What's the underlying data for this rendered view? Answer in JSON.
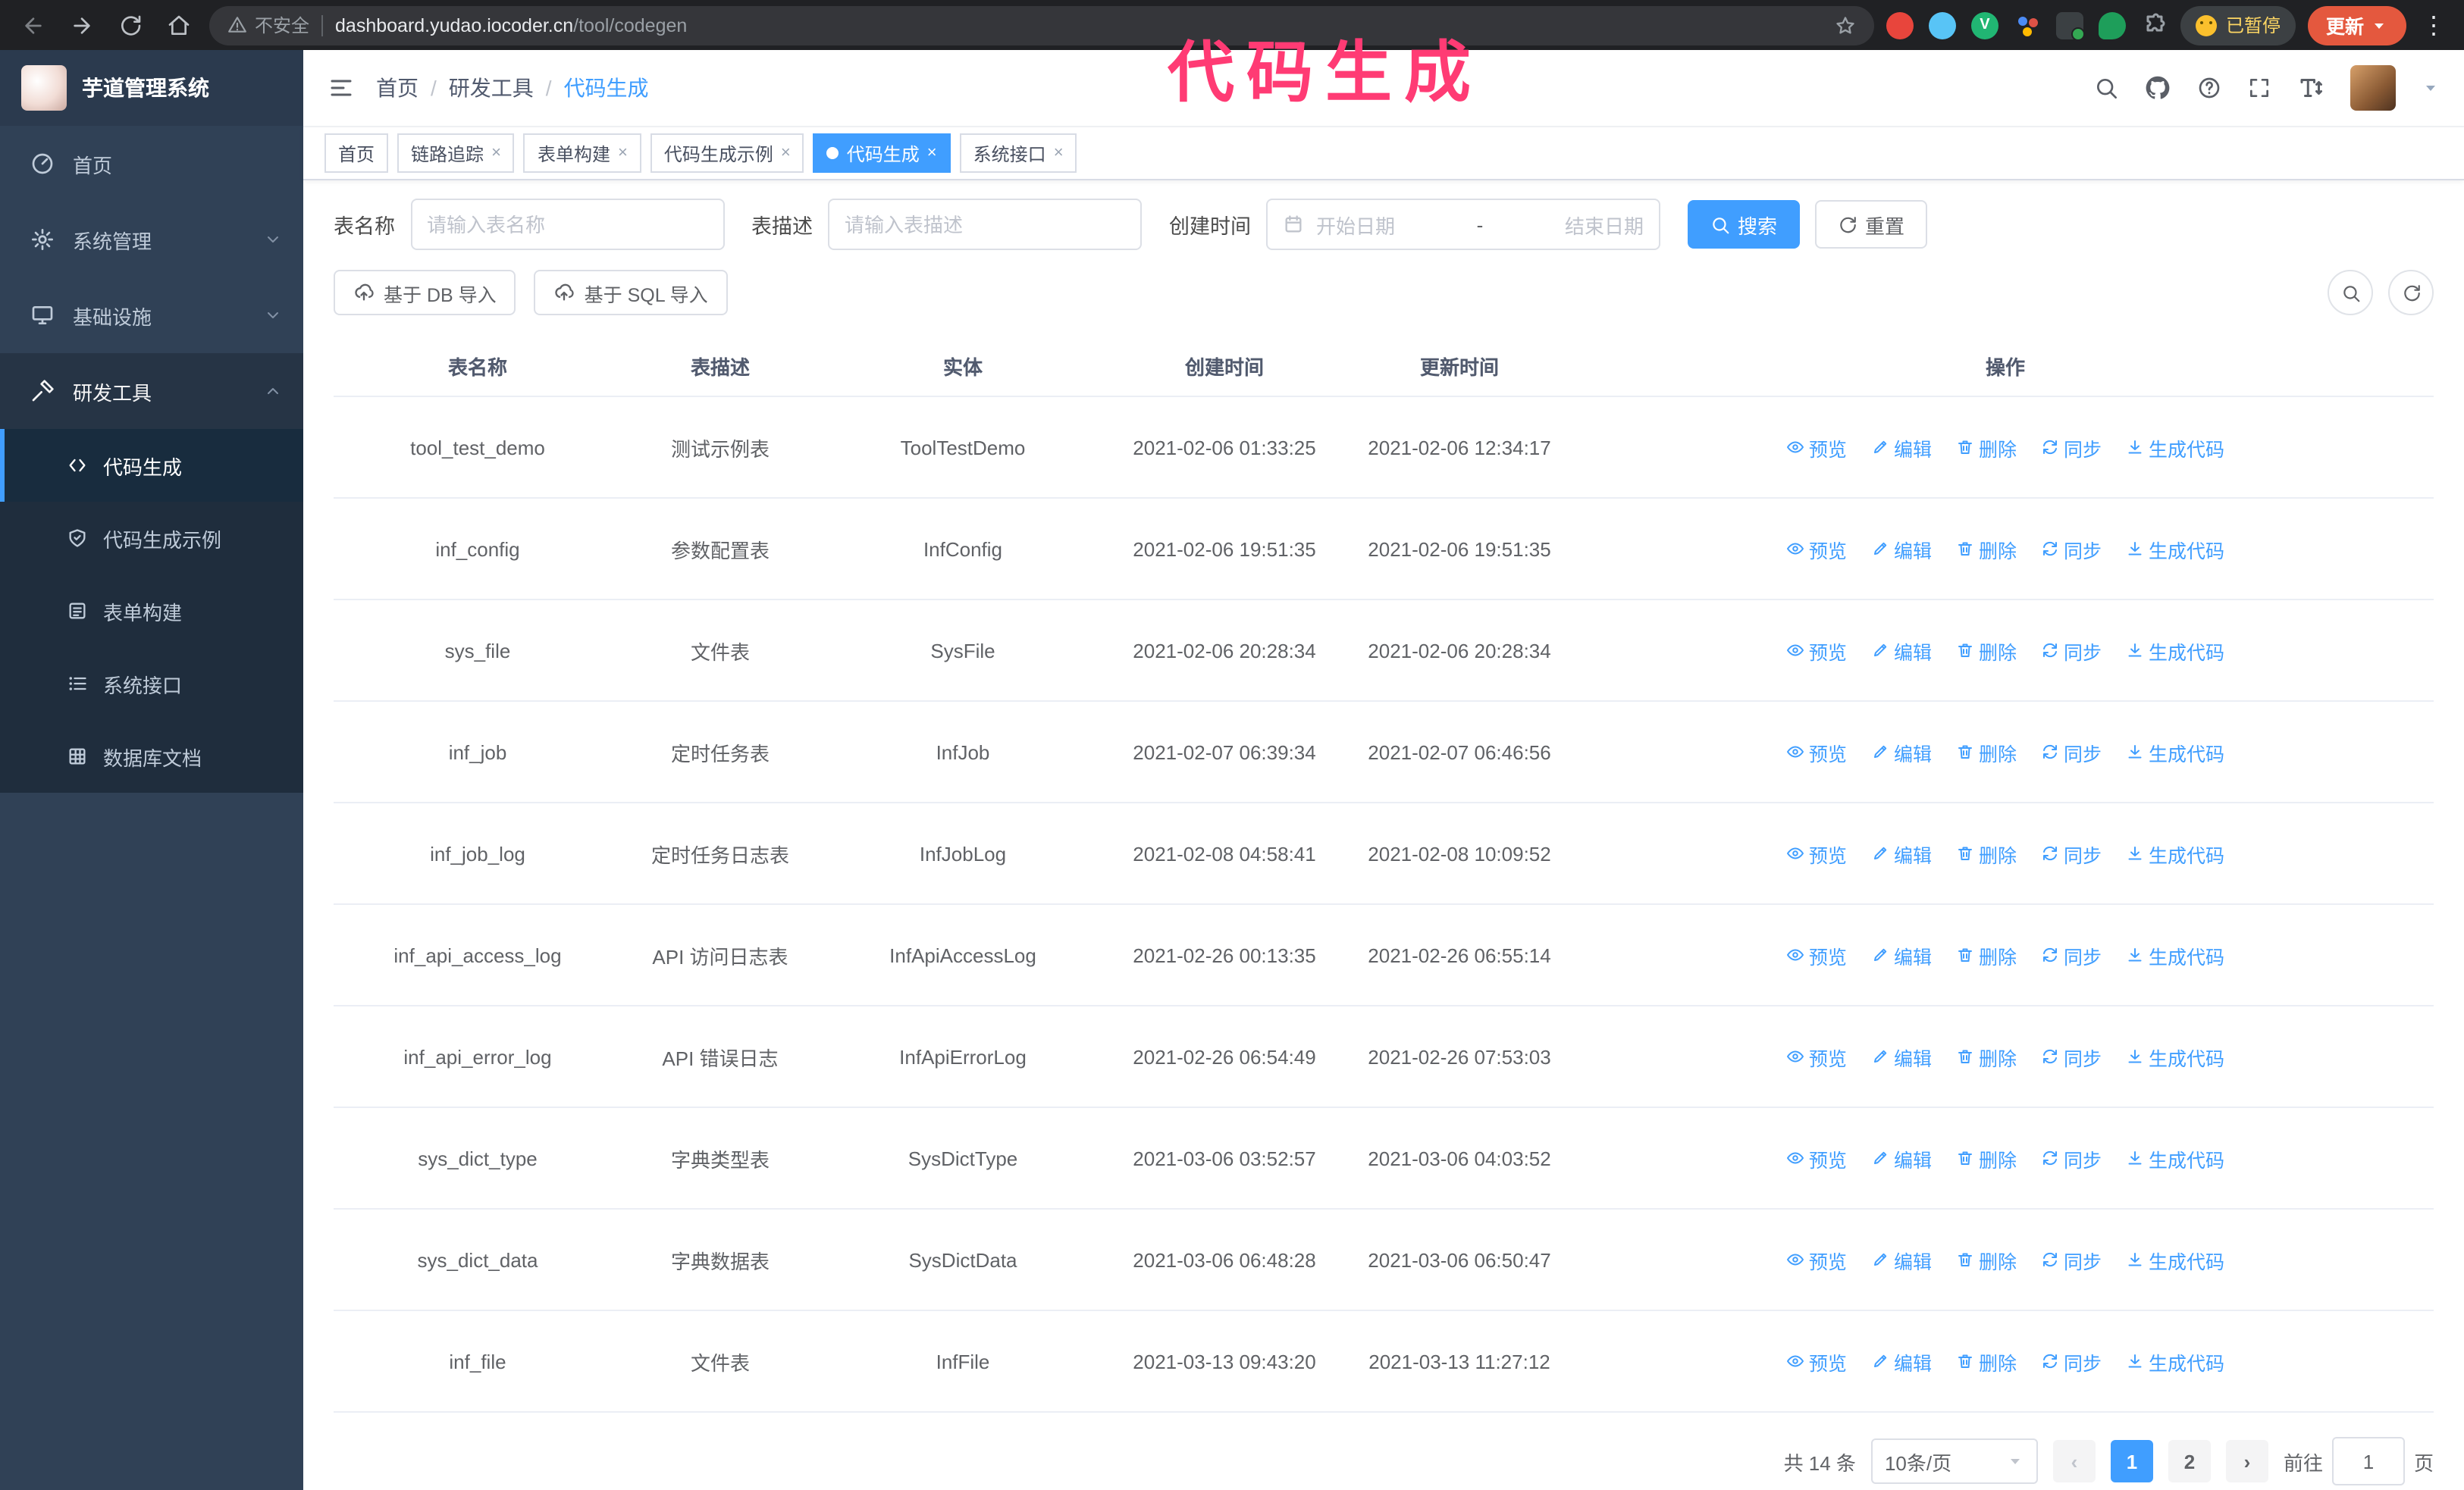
{
  "browser": {
    "security_label": "不安全",
    "url_host": "dashboard.yudao.iocoder.cn",
    "url_path": "/tool/codegen",
    "paused_label": "已暂停",
    "update_label": "更新"
  },
  "annotation": {
    "text": "代码生成"
  },
  "sidebar": {
    "logo_title": "芋道管理系统",
    "menu": [
      {
        "label": "首页"
      },
      {
        "label": "系统管理"
      },
      {
        "label": "基础设施"
      },
      {
        "label": "研发工具"
      }
    ],
    "submenu": [
      {
        "label": "代码生成"
      },
      {
        "label": "代码生成示例"
      },
      {
        "label": "表单构建"
      },
      {
        "label": "系统接口"
      },
      {
        "label": "数据库文档"
      }
    ]
  },
  "header": {
    "breadcrumb": [
      "首页",
      "研发工具",
      "代码生成"
    ]
  },
  "tabs": [
    {
      "label": "首页"
    },
    {
      "label": "链路追踪"
    },
    {
      "label": "表单构建"
    },
    {
      "label": "代码生成示例"
    },
    {
      "label": "代码生成"
    },
    {
      "label": "系统接口"
    }
  ],
  "filters": {
    "table_name_label": "表名称",
    "table_name_placeholder": "请输入表名称",
    "table_desc_label": "表描述",
    "table_desc_placeholder": "请输入表描述",
    "create_time_label": "创建时间",
    "start_placeholder": "开始日期",
    "range_separator": "-",
    "end_placeholder": "结束日期",
    "search_label": "搜索",
    "reset_label": "重置"
  },
  "toolbar": {
    "import_db": "基于 DB 导入",
    "import_sql": "基于 SQL 导入"
  },
  "table": {
    "columns": [
      "表名称",
      "表描述",
      "实体",
      "创建时间",
      "更新时间",
      "操作"
    ],
    "actions": [
      "预览",
      "编辑",
      "删除",
      "同步",
      "生成代码"
    ],
    "rows": [
      {
        "name": "tool_test_demo",
        "desc": "测试示例表",
        "entity": "ToolTestDemo",
        "created": "2021-02-06 01:33:25",
        "updated": "2021-02-06 12:34:17"
      },
      {
        "name": "inf_config",
        "desc": "参数配置表",
        "entity": "InfConfig",
        "created": "2021-02-06 19:51:35",
        "updated": "2021-02-06 19:51:35"
      },
      {
        "name": "sys_file",
        "desc": "文件表",
        "entity": "SysFile",
        "created": "2021-02-06 20:28:34",
        "updated": "2021-02-06 20:28:34"
      },
      {
        "name": "inf_job",
        "desc": "定时任务表",
        "entity": "InfJob",
        "created": "2021-02-07 06:39:34",
        "updated": "2021-02-07 06:46:56"
      },
      {
        "name": "inf_job_log",
        "desc": "定时任务日志表",
        "entity": "InfJobLog",
        "created": "2021-02-08 04:58:41",
        "updated": "2021-02-08 10:09:52"
      },
      {
        "name": "inf_api_access_log",
        "desc": "API 访问日志表",
        "entity": "InfApiAccessLog",
        "created": "2021-02-26 00:13:35",
        "updated": "2021-02-26 06:55:14"
      },
      {
        "name": "inf_api_error_log",
        "desc": "API 错误日志",
        "entity": "InfApiErrorLog",
        "created": "2021-02-26 06:54:49",
        "updated": "2021-02-26 07:53:03"
      },
      {
        "name": "sys_dict_type",
        "desc": "字典类型表",
        "entity": "SysDictType",
        "created": "2021-03-06 03:52:57",
        "updated": "2021-03-06 04:03:52"
      },
      {
        "name": "sys_dict_data",
        "desc": "字典数据表",
        "entity": "SysDictData",
        "created": "2021-03-06 06:48:28",
        "updated": "2021-03-06 06:50:47"
      },
      {
        "name": "inf_file",
        "desc": "文件表",
        "entity": "InfFile",
        "created": "2021-03-13 09:43:20",
        "updated": "2021-03-13 11:27:12"
      }
    ]
  },
  "pagination": {
    "total": "共 14 条",
    "page_size": "10条/页",
    "pages": [
      "1",
      "2"
    ],
    "goto_label": "前往",
    "goto_value": "1",
    "goto_suffix": "页"
  }
}
